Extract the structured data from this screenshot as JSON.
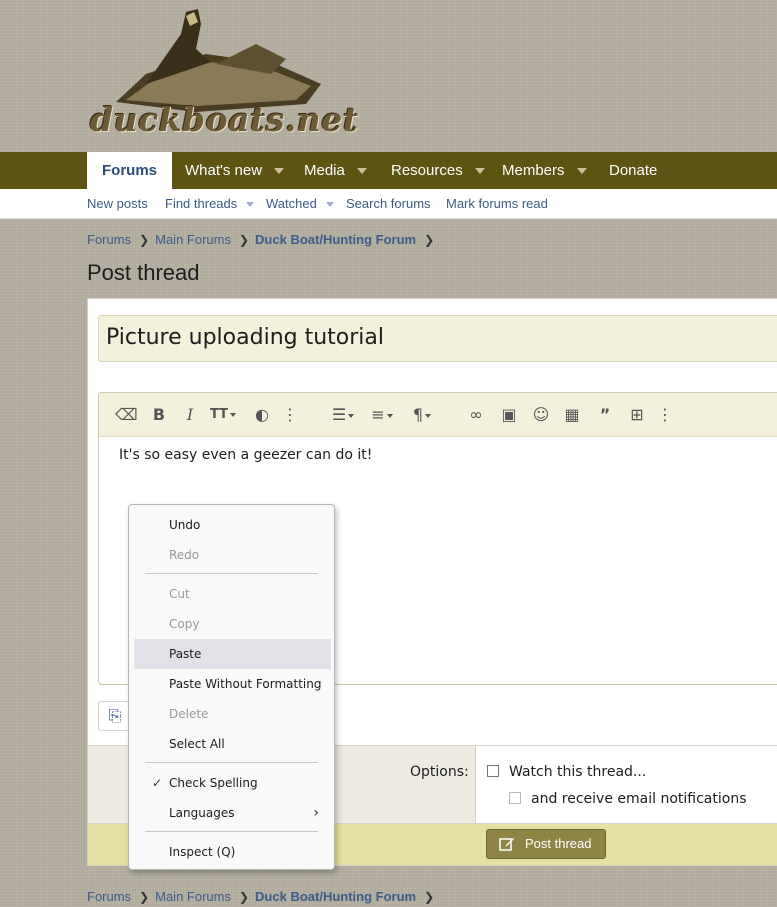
{
  "site": {
    "logo_text": "duckboats.net"
  },
  "nav": {
    "items": [
      {
        "label": "Forums"
      },
      {
        "label": "What's new"
      },
      {
        "label": "Media"
      },
      {
        "label": "Resources"
      },
      {
        "label": "Members"
      },
      {
        "label": "Donate"
      }
    ]
  },
  "subnav": {
    "items": [
      {
        "label": "New posts"
      },
      {
        "label": "Find threads"
      },
      {
        "label": "Watched"
      },
      {
        "label": "Search forums"
      },
      {
        "label": "Mark forums read"
      }
    ]
  },
  "breadcrumb": [
    "Forums",
    "Main Forums",
    "Duck Boat/Hunting Forum"
  ],
  "page_title": "Post thread",
  "form": {
    "title_value": "Picture uploading tutorial",
    "editor_text": "It's so easy even a geezer can do it!",
    "options_label": "Options:",
    "watch_label": "Watch this thread...",
    "email_label": "and receive email notifications",
    "submit_label": "Post thread"
  },
  "context_menu": {
    "items": [
      {
        "label": "Undo",
        "enabled": true
      },
      {
        "label": "Redo",
        "enabled": false
      },
      {
        "label": "Cut",
        "enabled": false
      },
      {
        "label": "Copy",
        "enabled": false
      },
      {
        "label": "Paste",
        "enabled": true,
        "highlighted": true
      },
      {
        "label": "Paste Without Formatting",
        "enabled": true
      },
      {
        "label": "Delete",
        "enabled": false
      },
      {
        "label": "Select All",
        "enabled": true
      },
      {
        "label": "Check Spelling",
        "enabled": true,
        "checked": true
      },
      {
        "label": "Languages",
        "enabled": true,
        "submenu": true
      },
      {
        "label": "Inspect (Q)",
        "enabled": true
      }
    ]
  },
  "colors": {
    "nav_bg": "#5d5313",
    "link": "#3c5b8a",
    "accent": "#8e8446"
  }
}
